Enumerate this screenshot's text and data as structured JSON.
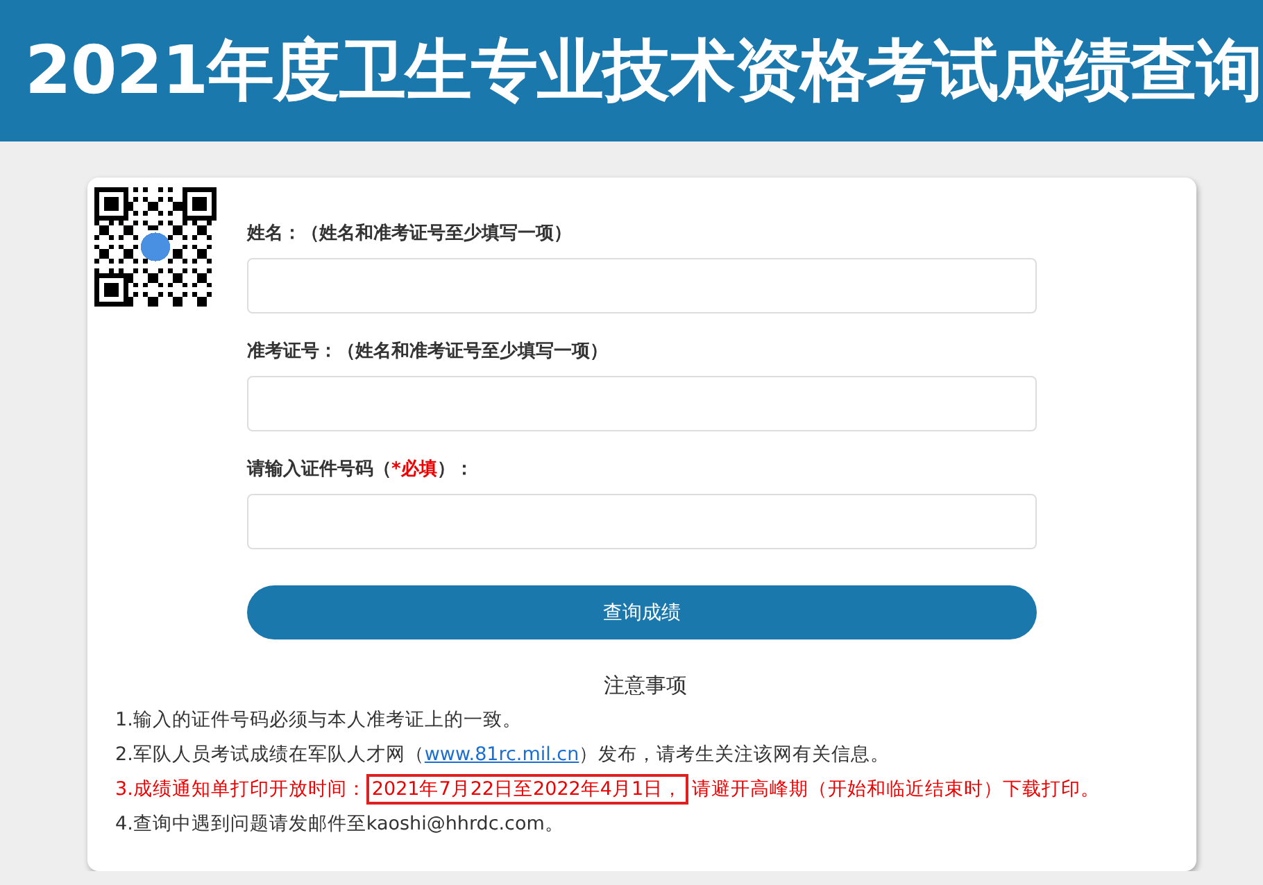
{
  "header": {
    "title": "2021年度卫生专业技术资格考试成绩查询"
  },
  "form": {
    "fields": [
      {
        "label": "姓名：",
        "hint": "（姓名和准考证号至少填写一项）"
      },
      {
        "label": "准考证号：",
        "hint": "（姓名和准考证号至少填写一项）"
      },
      {
        "label": "请输入证件号码（",
        "required_mark": "*必填",
        "hint": "）："
      }
    ],
    "submit": "查询成绩"
  },
  "notes": {
    "title": "注意事项",
    "items": [
      {
        "emphasis": false,
        "segments": [
          {
            "kind": "text",
            "text": "1.输入的证件号码必须与本人准考证上的一致。"
          }
        ]
      },
      {
        "emphasis": false,
        "segments": [
          {
            "kind": "text",
            "text": "2.军队人员考试成绩在军队人才网（"
          },
          {
            "kind": "link",
            "text": "www.81rc.mil.cn"
          },
          {
            "kind": "text",
            "text": "）发布，请考生关注该网有关信息。"
          }
        ]
      },
      {
        "emphasis": true,
        "segments": [
          {
            "kind": "text",
            "text": "3.成绩通知单打印开放时间："
          },
          {
            "kind": "boxed",
            "text": "2021年7月22日至2022年4月1日，"
          },
          {
            "kind": "text",
            "text": "请避开高峰期（开始和临近结束时）下载打印。"
          }
        ]
      },
      {
        "emphasis": false,
        "segments": [
          {
            "kind": "text",
            "text": "4.查询中遇到问题请发邮件至kaoshi@hhrdc.com。"
          }
        ]
      }
    ]
  }
}
